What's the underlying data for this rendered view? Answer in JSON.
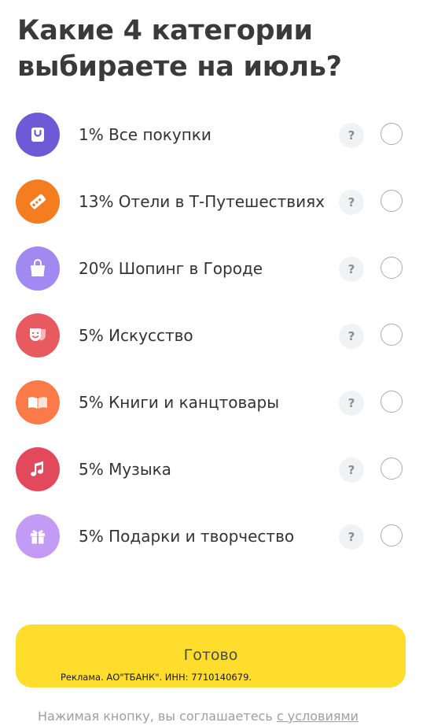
{
  "title": "Какие 4 категории выбираете на июль?",
  "categories": [
    {
      "label": "1% Все покупки",
      "icon": "shopping-bag-icon",
      "color": "#6e5ad6",
      "selected": false
    },
    {
      "label": "13% Отели в Т-Путешествиях",
      "icon": "hotel-key-tag-icon",
      "color": "#f47d20",
      "selected": false
    },
    {
      "label": "20% Шопинг в Городе",
      "icon": "shopping-bag-icon",
      "color": "#a08af2",
      "selected": false
    },
    {
      "label": "5% Искусство",
      "icon": "theater-masks-icon",
      "color": "#e85a5f",
      "selected": false
    },
    {
      "label": "5% Книги и канцтовары",
      "icon": "open-book-icon",
      "color": "#fa7a48",
      "selected": false
    },
    {
      "label": "5% Музыка",
      "icon": "music-note-icon",
      "color": "#e24a5c",
      "selected": false
    },
    {
      "label": "5% Подарки и творчество",
      "icon": "gift-icon",
      "color": "#c39af4",
      "selected": false
    }
  ],
  "help_label": "?",
  "done_button": {
    "label": "Готово",
    "ad_text": "Реклама. АО\"ТБАНК\". ИНН: 7710140679.",
    "color": "#ffdd2d"
  },
  "terms": {
    "text": "Нажимая кнопку, вы соглашаетесь ",
    "link": "с условиями"
  }
}
